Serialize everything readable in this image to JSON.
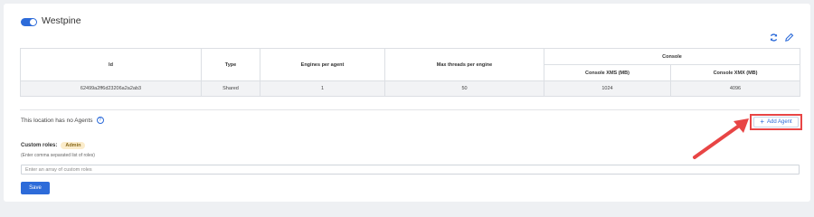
{
  "location": {
    "name": "Westpine",
    "enabled": true
  },
  "actions": {
    "refresh_icon": "refresh-icon",
    "edit_icon": "pencil-icon"
  },
  "table": {
    "headers": {
      "id": "Id",
      "type": "Type",
      "engines": "Engines per agent",
      "threads": "Max threads per engine",
      "console": "Console",
      "console_xms": "Console XMS (MB)",
      "console_xmx": "Console XMX (MB)"
    },
    "rows": [
      {
        "id": "62499a2ff6d23206a2a2ab3",
        "type": "Shared",
        "engines": "1",
        "threads": "50",
        "console_xms": "1024",
        "console_xmx": "4096"
      }
    ]
  },
  "agents": {
    "empty_text": "This location has no Agents",
    "info_icon": "info-icon",
    "add_label": "Add Agent"
  },
  "roles": {
    "label": "Custom roles:",
    "tag": "Admin",
    "hint": "(Enter comma separated list of roles)",
    "placeholder": "Enter an array of custom roles",
    "value": ""
  },
  "save_label": "Save",
  "colors": {
    "accent": "#2d6bd9",
    "highlight": "#e84545",
    "tag_bg": "#fbeccb"
  }
}
